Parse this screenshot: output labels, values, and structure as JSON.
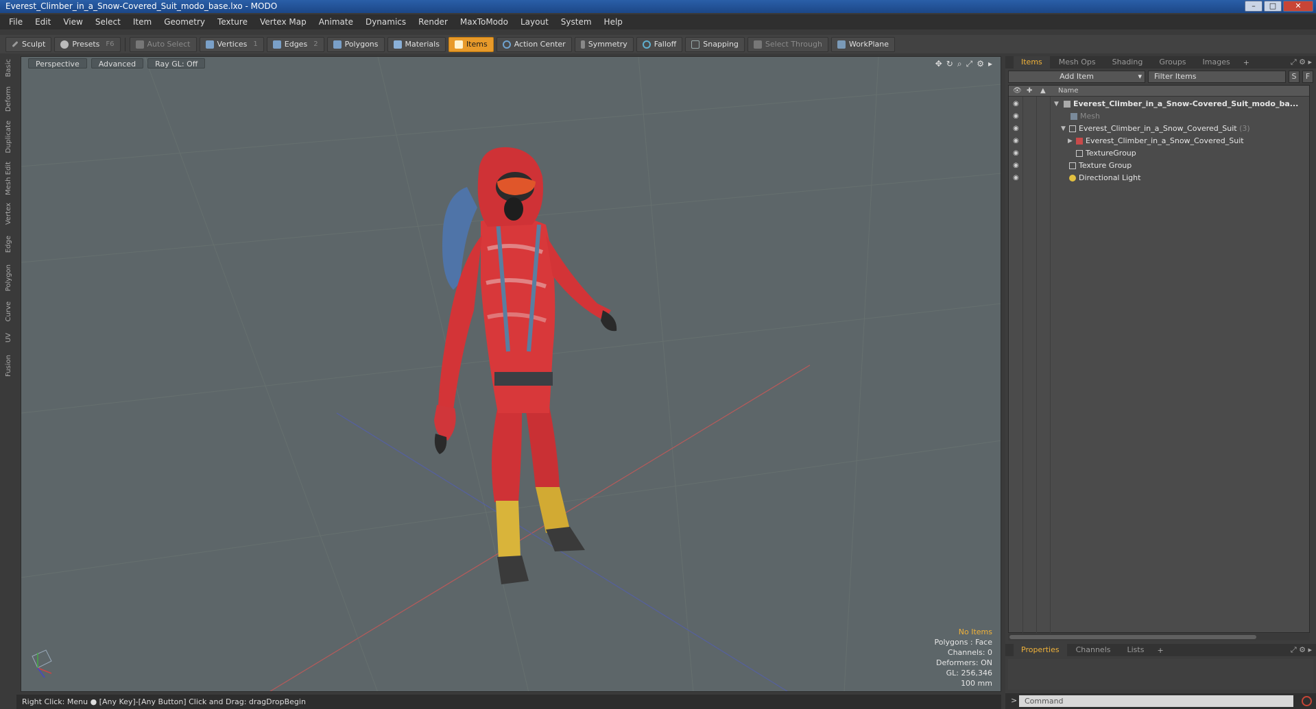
{
  "window": {
    "title": "Everest_Climber_in_a_Snow-Covered_Suit_modo_base.lxo - MODO"
  },
  "menu": [
    "File",
    "Edit",
    "View",
    "Select",
    "Item",
    "Geometry",
    "Texture",
    "Vertex Map",
    "Animate",
    "Dynamics",
    "Render",
    "MaxToModo",
    "Layout",
    "System",
    "Help"
  ],
  "toolbar": {
    "sculpt": "Sculpt",
    "presets": "Presets",
    "presets_key": "F6",
    "auto_select": "Auto Select",
    "vertices": "Vertices",
    "vertices_key": "1",
    "edges": "Edges",
    "edges_key": "2",
    "polygons": "Polygons",
    "materials": "Materials",
    "items": "Items",
    "action_center": "Action Center",
    "symmetry": "Symmetry",
    "falloff": "Falloff",
    "snapping": "Snapping",
    "select_through": "Select Through",
    "workplane": "WorkPlane"
  },
  "left_tabs": [
    "Basic",
    "Deform",
    "Duplicate",
    "Mesh Edit",
    "Vertex",
    "Edge",
    "Polygon",
    "Curve",
    "UV",
    "Fusion"
  ],
  "viewport": {
    "view": "Perspective",
    "mode": "Advanced",
    "raygl": "Ray GL: Off",
    "readout": {
      "selection": "No Items",
      "polygons": "Polygons : Face",
      "channels": "Channels: 0",
      "deformers": "Deformers: ON",
      "gl": "GL: 256,346",
      "scale": "100 mm"
    }
  },
  "status": "Right Click: Menu ● [Any Key]-[Any Button] Click and Drag: dragDropBegin",
  "right_tabs": [
    "Items",
    "Mesh Ops",
    "Shading",
    "Groups",
    "Images"
  ],
  "add_item": "Add Item",
  "filter_placeholder": "Filter Items",
  "filter_s": "S",
  "filter_f": "F",
  "list_header": {
    "name": "Name"
  },
  "items": [
    {
      "label": "Everest_Climber_in_a_Snow-Covered_Suit_modo_ba...",
      "count": ""
    },
    {
      "label": "Mesh",
      "count": ""
    },
    {
      "label": "Everest_Climber_in_a_Snow_Covered_Suit",
      "count": "(3)"
    },
    {
      "label": "Everest_Climber_in_a_Snow_Covered_Suit",
      "count": ""
    },
    {
      "label": "TextureGroup",
      "count": ""
    },
    {
      "label": "Texture Group",
      "count": ""
    },
    {
      "label": "Directional Light",
      "count": ""
    }
  ],
  "bottom_tabs": [
    "Properties",
    "Channels",
    "Lists"
  ],
  "command_placeholder": "Command",
  "colors": {
    "accent": "#e89a2a",
    "viewport_bg": "#5d6669",
    "suit_red": "#d8383a"
  }
}
